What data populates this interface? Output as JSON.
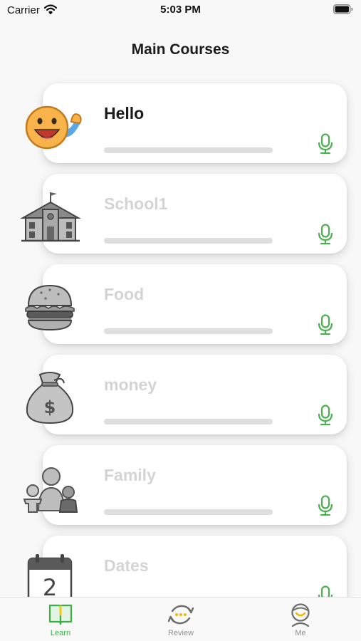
{
  "status_bar": {
    "carrier": "Carrier",
    "time": "5:03 PM"
  },
  "header": {
    "title": "Main Courses"
  },
  "courses": [
    {
      "title": "Hello",
      "icon": "smiley-wave-icon",
      "active": true,
      "progress": 0
    },
    {
      "title": "School1",
      "icon": "school-building-icon",
      "active": false,
      "progress": 0
    },
    {
      "title": "Food",
      "icon": "hamburger-icon",
      "active": false,
      "progress": 0
    },
    {
      "title": "money",
      "icon": "money-bag-icon",
      "active": false,
      "progress": 0
    },
    {
      "title": "Family",
      "icon": "family-icon",
      "active": false,
      "progress": 0
    },
    {
      "title": "Dates",
      "icon": "calendar-icon",
      "active": false,
      "progress": 0
    }
  ],
  "tab_bar": {
    "tabs": [
      {
        "label": "Learn",
        "icon": "book-icon",
        "active": true
      },
      {
        "label": "Review",
        "icon": "review-cycle-icon",
        "active": false
      },
      {
        "label": "Me",
        "icon": "person-icon",
        "active": false
      }
    ]
  },
  "colors": {
    "accent_green": "#3cb043",
    "mic_green": "#4caf50",
    "inactive_title": "#d4d4d4",
    "progress_track": "#dedede",
    "background": "#f8f8f8"
  },
  "calendar_day": "2"
}
